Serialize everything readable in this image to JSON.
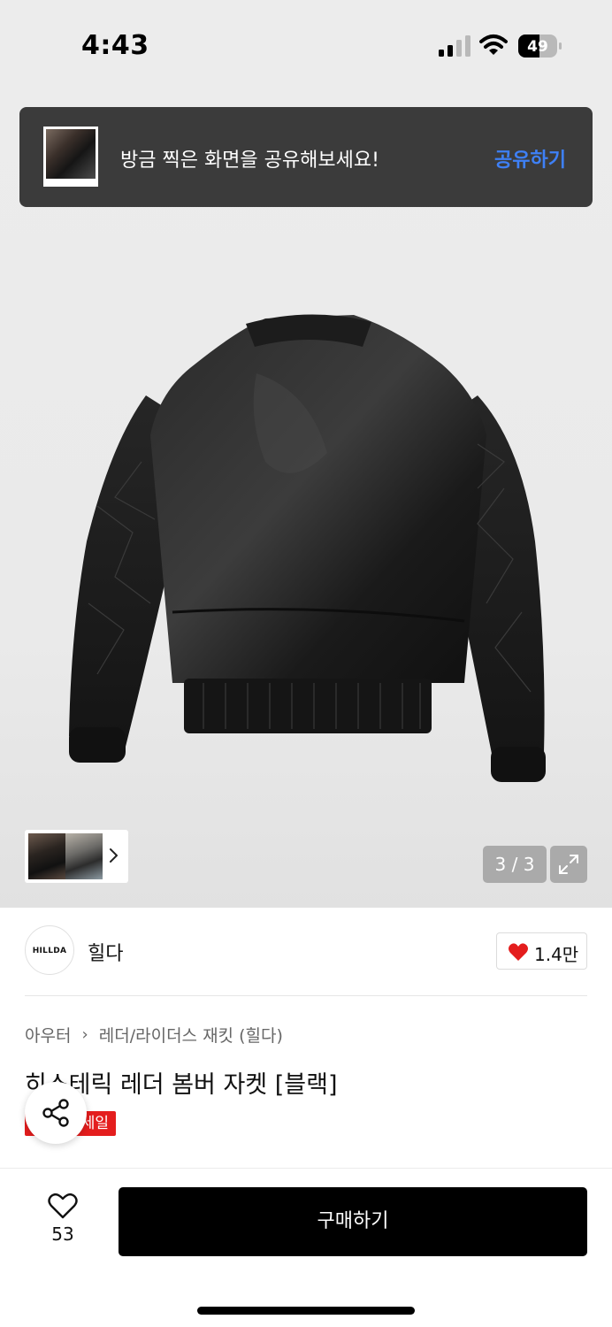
{
  "status_bar": {
    "time": "4:43",
    "battery_level": "49",
    "icons": [
      "cellular-signal-icon",
      "wifi-icon",
      "battery-icon"
    ]
  },
  "toast": {
    "message": "방금 찍은 화면을 공유해보세요!",
    "action_label": "공유하기",
    "action_color": "#3e80f6"
  },
  "gallery": {
    "page_indicator": "3 / 3",
    "current_page": 3,
    "total_pages": 3
  },
  "brand": {
    "logo_text": "HILLDA",
    "name": "힐다",
    "like_count": "1.4만"
  },
  "product": {
    "breadcrumb": [
      "아우터",
      "레더/라이더스 재킷 (힐다)"
    ],
    "title": "히스테릭 레더 봄버 자켓 [블랙]",
    "badge": "세일",
    "badge_color": "#e41d1d"
  },
  "bottom_bar": {
    "wish_count": "53",
    "buy_label": "구매하기"
  }
}
